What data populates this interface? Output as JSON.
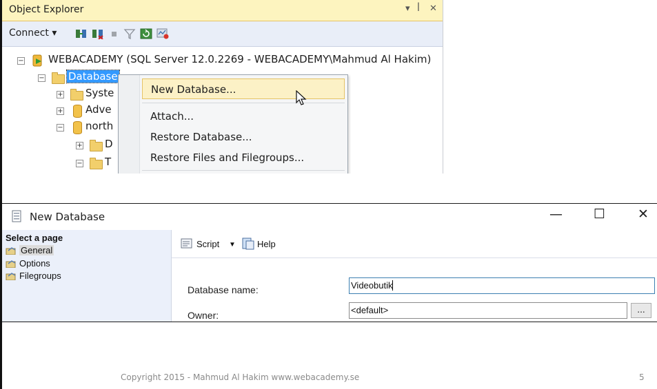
{
  "object_explorer": {
    "title": "Object Explorer",
    "title_controls": [
      "▾",
      "ꟾ",
      "✕"
    ],
    "toolbar": {
      "connect_label": "Connect ▾"
    },
    "tree": {
      "server": "WEBACADEMY (SQL Server 12.0.2269 - WEBACADEMY\\Mahmud Al Hakim)",
      "databases": "Database",
      "system": "Syste",
      "adventure": "Adve",
      "north": "north",
      "child_d": "D",
      "child_t": "T"
    }
  },
  "context_menu": {
    "items": [
      "New Database...",
      "Attach...",
      "Restore Database...",
      "Restore Files and Filegroups..."
    ]
  },
  "new_database_dialog": {
    "title": "New Database",
    "window_controls": {
      "minimize": "—",
      "maximize": "☐",
      "close": "✕"
    },
    "select_page_header": "Select a page",
    "pages": [
      "General",
      "Options",
      "Filegroups"
    ],
    "toolbar": {
      "script_label": "Script",
      "help_label": "Help"
    },
    "fields": {
      "database_name_label": "Database name:",
      "database_name_value": "Videobutik",
      "owner_label": "Owner:",
      "owner_value": "<default>",
      "browse_label": "..."
    }
  },
  "footer": {
    "copyright": "Copyright 2015 - Mahmud Al Hakim www.webacademy.se",
    "page_number": "5"
  }
}
